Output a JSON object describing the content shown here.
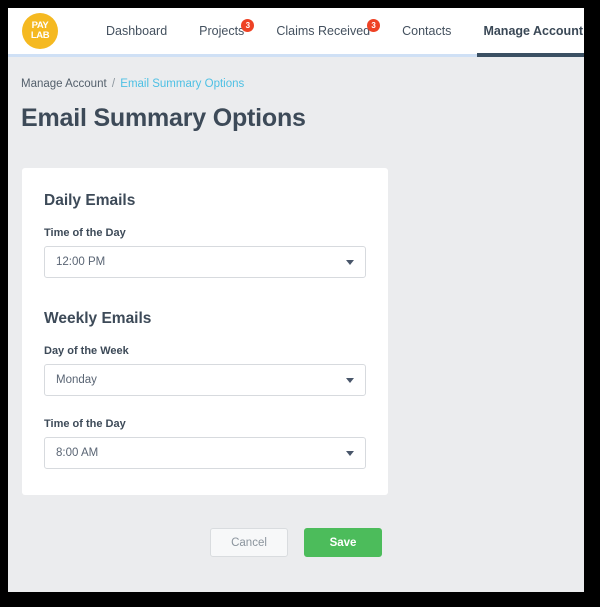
{
  "brand": {
    "line1": "PAY",
    "line2": "LAB",
    "color": "#f5b921"
  },
  "nav": {
    "items": [
      {
        "label": "Dashboard",
        "badge": null,
        "active": false
      },
      {
        "label": "Projects",
        "badge": "3",
        "active": false
      },
      {
        "label": "Claims Received",
        "badge": "3",
        "active": false
      },
      {
        "label": "Contacts",
        "badge": null,
        "active": false
      },
      {
        "label": "Manage Account",
        "badge": null,
        "active": true
      }
    ],
    "badge_color": "#ee4225",
    "active_underline_color": "#3b5063"
  },
  "breadcrumb": {
    "parent": "Manage Account",
    "separator": "/",
    "current": "Email Summary Options",
    "link_color": "#4ec0e4"
  },
  "page": {
    "title": "Email Summary Options"
  },
  "card": {
    "daily": {
      "heading": "Daily Emails",
      "time_label": "Time of the Day",
      "time_value": "12:00 PM"
    },
    "weekly": {
      "heading": "Weekly Emails",
      "day_label": "Day of the Week",
      "day_value": "Monday",
      "time_label": "Time of the Day",
      "time_value": "8:00 AM"
    }
  },
  "actions": {
    "cancel_label": "Cancel",
    "save_label": "Save",
    "save_color": "#4cbc5b"
  }
}
